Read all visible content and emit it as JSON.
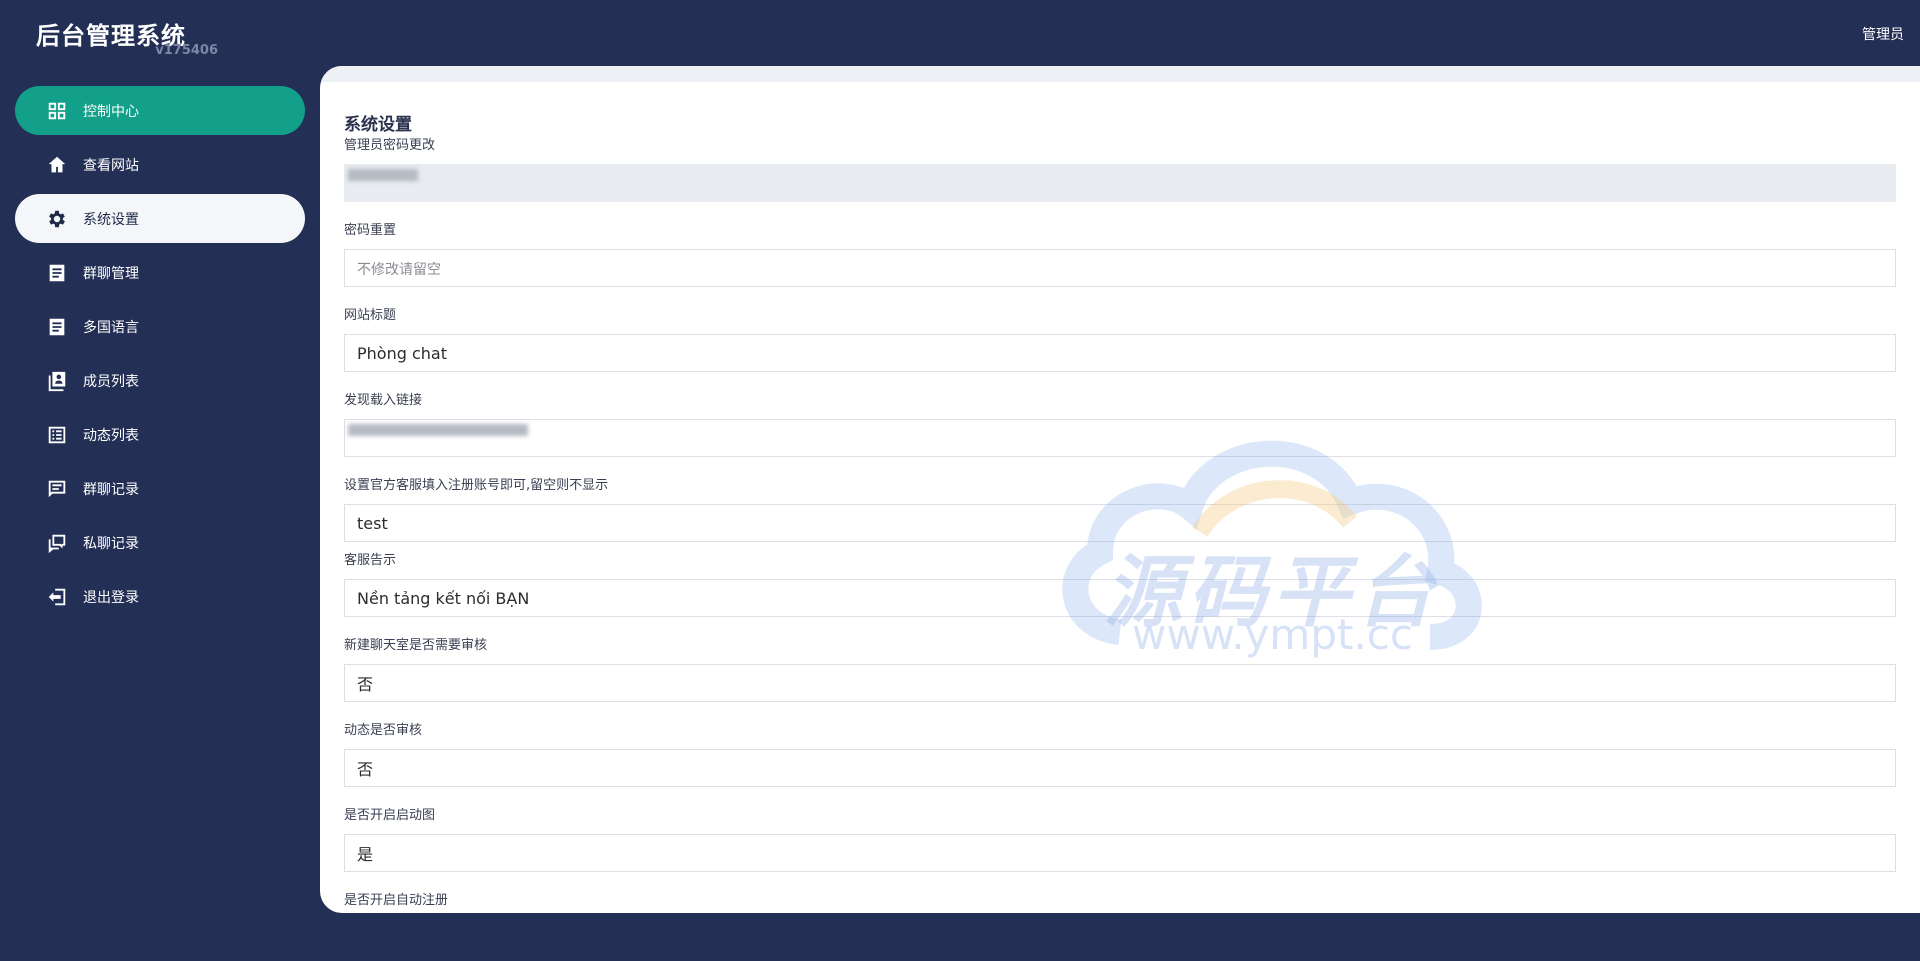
{
  "app": {
    "title": "后台管理系统",
    "version": "v175406"
  },
  "topbar": {
    "user": "管理员"
  },
  "sidebar": {
    "items": [
      {
        "label": "控制中心",
        "icon": "dashboard-icon",
        "state": "active"
      },
      {
        "label": "查看网站",
        "icon": "home-icon",
        "state": ""
      },
      {
        "label": "系统设置",
        "icon": "gear-icon",
        "state": "selected"
      },
      {
        "label": "群聊管理",
        "icon": "document-icon",
        "state": ""
      },
      {
        "label": "多国语言",
        "icon": "document-icon",
        "state": ""
      },
      {
        "label": "成员列表",
        "icon": "contacts-icon",
        "state": ""
      },
      {
        "label": "动态列表",
        "icon": "list-icon",
        "state": ""
      },
      {
        "label": "群聊记录",
        "icon": "message-icon",
        "state": ""
      },
      {
        "label": "私聊记录",
        "icon": "chat-icon",
        "state": ""
      },
      {
        "label": "退出登录",
        "icon": "logout-icon",
        "state": ""
      }
    ]
  },
  "form": {
    "title": "系统设置",
    "admin_password_label": "管理员密码更改",
    "password_reset_label": "密码重置",
    "password_reset_placeholder": "不修改请留空",
    "site_title_label": "网站标题",
    "site_title_value": "Phòng chat",
    "download_link_label": "发现载入链接",
    "service_label": "设置官方客服填入注册账号即可,留空则不显示",
    "service_value": "test",
    "service_notice_label": "客服告示",
    "service_notice_value": "Nền tảng kết nối BẠN",
    "new_room_review_label": "新建聊天室是否需要审核",
    "new_room_review_value": "否",
    "moment_review_label": "动态是否审核",
    "moment_review_value": "否",
    "splash_label": "是否开启启动图",
    "splash_value": "是",
    "auto_register_label": "是否开启自动注册"
  },
  "watermark": {
    "text": "源码平台",
    "url": "www.ympt.cc"
  },
  "colors": {
    "sidebar_bg": "#232f55",
    "active": "#13a08a",
    "selected": "#f4f6f9"
  }
}
